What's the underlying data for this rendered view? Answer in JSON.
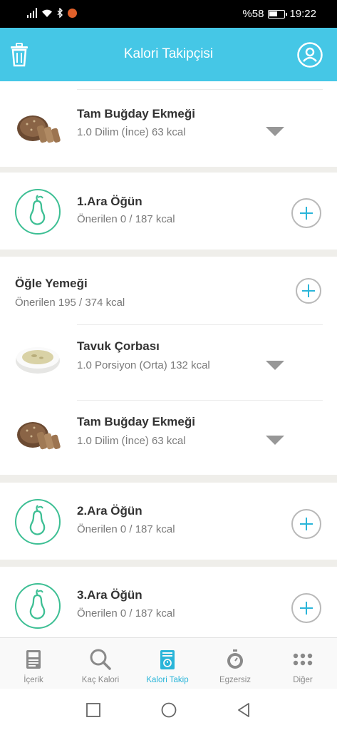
{
  "status_bar": {
    "battery": "%58",
    "time": "19:22",
    "battery_level": 0.58
  },
  "app_bar": {
    "title": "Kalori Takipçisi"
  },
  "food_items": [
    {
      "name": "Tam Buğday Ekmeği",
      "portion": "1.0 Dilim (İnce) 63 kcal",
      "image": "bread"
    },
    {
      "name": "Tavuk Çorbası",
      "portion": "1.0 Porsiyon (Orta) 132 kcal",
      "image": "soup"
    },
    {
      "name": "Tam Buğday Ekmeği",
      "portion": "1.0 Dilim (İnce) 63 kcal",
      "image": "bread"
    }
  ],
  "snacks": [
    {
      "title": "1.Ara Öğün",
      "recommended": "Önerilen 0 / 187 kcal"
    },
    {
      "title": "2.Ara Öğün",
      "recommended": "Önerilen 0 / 187 kcal"
    },
    {
      "title": "3.Ara Öğün",
      "recommended": "Önerilen 0 / 187 kcal"
    }
  ],
  "lunch": {
    "title": "Öğle Yemeği",
    "recommended": "Önerilen 195 / 374 kcal"
  },
  "bottom_nav": [
    {
      "label": "İçerik",
      "icon": "article-icon"
    },
    {
      "label": "Kaç Kalori",
      "icon": "search-icon"
    },
    {
      "label": "Kalori Takip",
      "icon": "tracker-icon",
      "active": true
    },
    {
      "label": "Egzersiz",
      "icon": "stopwatch-icon"
    },
    {
      "label": "Diğer",
      "icon": "more-dots-icon"
    }
  ],
  "colors": {
    "primary": "#45c7e6",
    "green": "#3dbf94",
    "active": "#2ab5d9"
  }
}
